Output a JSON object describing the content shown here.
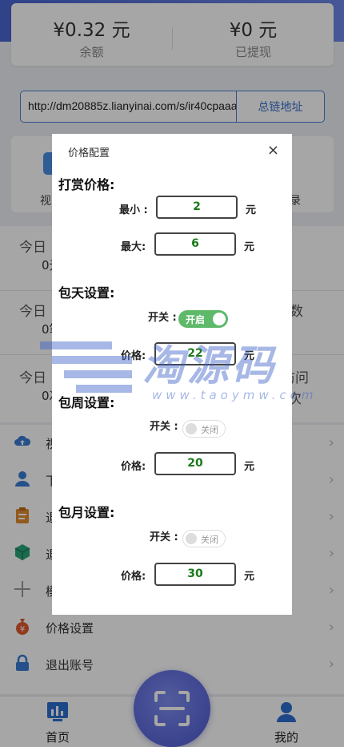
{
  "balance": {
    "amount": "¥0.32 元",
    "amount_label": "余额",
    "withdrawn": "¥0 元",
    "withdrawn_label": "已提现"
  },
  "link": {
    "url": "http://dm20885z.lianyinai.com/s/ir40cpaaa",
    "button": "总链地址"
  },
  "quick": {
    "left_label": "视",
    "right_label": "录"
  },
  "stats": [
    {
      "title": "今日",
      "value": "0元",
      "tail": "",
      "tail2": ""
    },
    {
      "title": "今日",
      "value": "0笔",
      "tail": "数",
      "tail2": ""
    },
    {
      "title": "今日",
      "value": "0次",
      "tail": "访问",
      "tail2": "次"
    }
  ],
  "menu": [
    {
      "label": "视",
      "icon": "cloud-upload-icon",
      "color": "#3a7bd5"
    },
    {
      "label": "下",
      "icon": "user-icon",
      "color": "#3a7bd5"
    },
    {
      "label": "退",
      "icon": "clipboard-icon",
      "color": "#e08a2e"
    },
    {
      "label": "退",
      "icon": "cube-icon",
      "color": "#2aa67a"
    },
    {
      "label": "模",
      "icon": "plus-icon",
      "color": "#999999"
    },
    {
      "label": "价格设置",
      "icon": "money-bag-icon",
      "color": "#e05a2e"
    },
    {
      "label": "退出账号",
      "icon": "lock-icon",
      "color": "#3a7bd5"
    }
  ],
  "tabs": {
    "home": "首页",
    "mine": "我的"
  },
  "watermark": {
    "text": "淘源码",
    "url": "www.taoymw.com"
  },
  "dialog": {
    "title": "价格配置",
    "close": "×",
    "reward": {
      "heading": "打赏价格:",
      "min_label": "最小 :",
      "min_value": "2",
      "max_label": "最大:",
      "max_value": "6",
      "unit": "元"
    },
    "daily": {
      "heading": "包天设置:",
      "switch_label": "开关 :",
      "switch_state": "开启",
      "price_label": "价格:",
      "price_value": "22",
      "unit": "元"
    },
    "weekly": {
      "heading": "包周设置:",
      "switch_label": "开关 :",
      "switch_state": "关闭",
      "price_label": "价格:",
      "price_value": "20",
      "unit": "元"
    },
    "monthly": {
      "heading": "包月设置:",
      "switch_label": "开关 :",
      "switch_state": "关闭",
      "price_label": "价格:",
      "price_value": "30",
      "unit": "元"
    }
  }
}
